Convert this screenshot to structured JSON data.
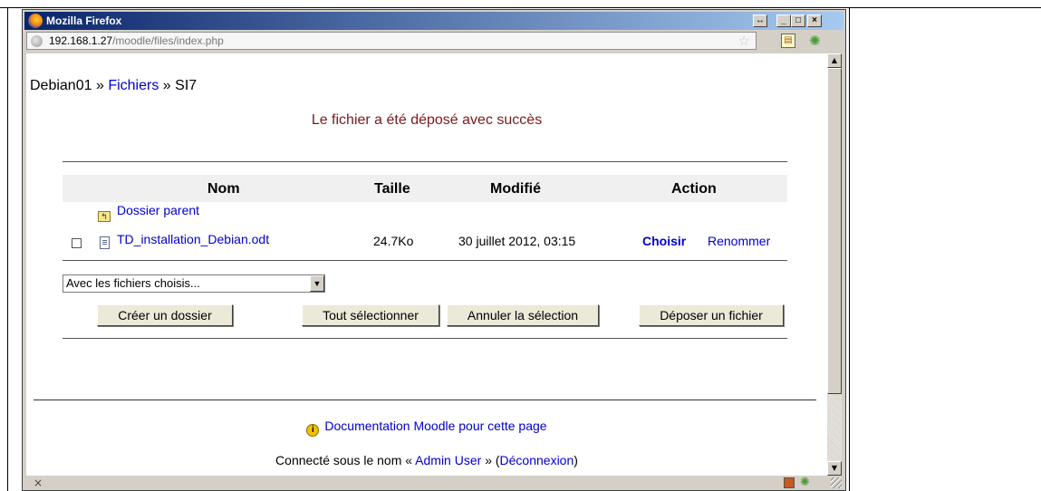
{
  "window": {
    "title": "Mozilla Firefox",
    "buttons": {
      "resize": "↔",
      "minimize": "_",
      "maximize": "□",
      "close": "×"
    }
  },
  "urlbar": {
    "host": "192.168.1.27",
    "path": "/moodle/files/index.php"
  },
  "page": {
    "breadcrumb": {
      "site": "Debian01",
      "sep1": "»",
      "files": "Fichiers",
      "sep2": "»",
      "course": "SI7"
    },
    "success_message": "Le fichier a été déposé avec succès",
    "table": {
      "headers": {
        "name": "Nom",
        "size": "Taille",
        "modified": "Modifié",
        "action": "Action"
      },
      "parent_folder": "Dossier parent",
      "file": {
        "name": "TD_installation_Debian.odt",
        "size": "24.7Ko",
        "modified": "30 juillet 2012, 03:15",
        "action_choose": "Choisir",
        "action_rename": "Renommer"
      }
    },
    "select": {
      "value": "Avec les fichiers choisis..."
    },
    "buttons": {
      "create_folder": "Créer un dossier",
      "select_all": "Tout sélectionner",
      "deselect": "Annuler la sélection",
      "upload": "Déposer un fichier"
    },
    "footer": {
      "docs_link": "Documentation Moodle pour cette page",
      "logged_prefix": "Connecté sous le nom «",
      "user": "Admin User",
      "logged_mid": "» (",
      "logout": "Déconnexion",
      "logged_suffix": ")"
    }
  },
  "statusbar": {
    "close": "×"
  },
  "colors": {
    "titlebar_start": "#0a246a",
    "link": "#0000cc",
    "success": "#7a1a1a",
    "chrome": "#d4d0c8"
  }
}
